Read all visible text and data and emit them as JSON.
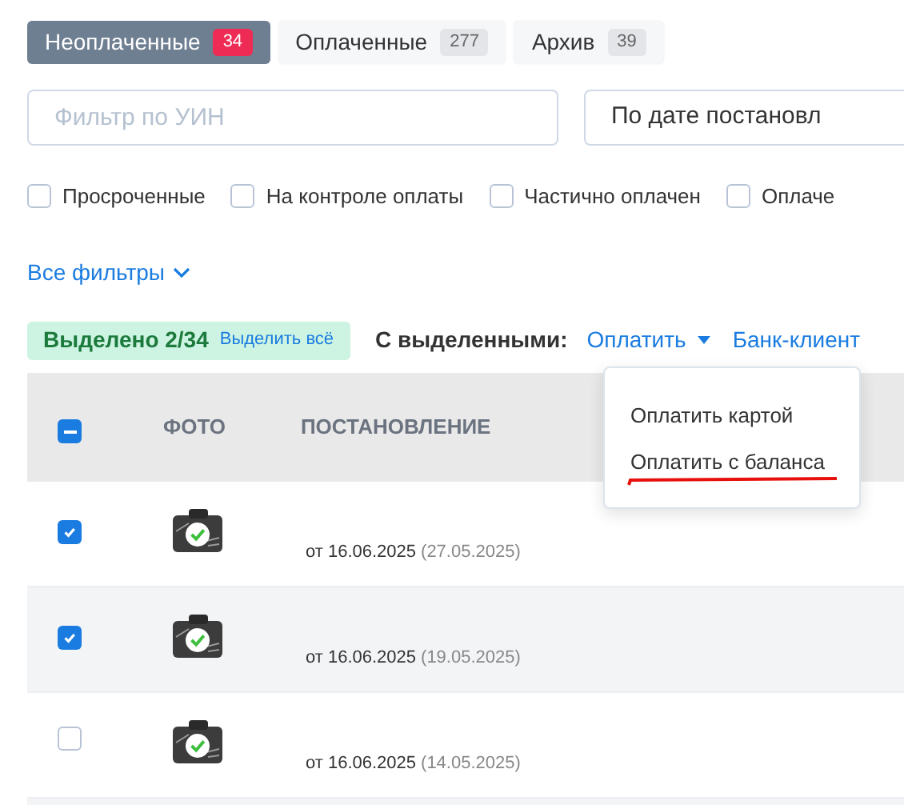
{
  "tabs": [
    {
      "label": "Неоплаченные",
      "count": "34",
      "selected": true
    },
    {
      "label": "Оплаченные",
      "count": "277",
      "selected": false
    },
    {
      "label": "Архив",
      "count": "39",
      "selected": false
    }
  ],
  "filter": {
    "placeholder": "Фильтр по УИН"
  },
  "sort": {
    "value": "По дате постановл"
  },
  "checkboxes": [
    {
      "label": "Просроченные",
      "checked": false
    },
    {
      "label": "На контроле оплаты",
      "checked": false
    },
    {
      "label": "Частично оплачен",
      "checked": false
    },
    {
      "label": "Оплаче",
      "checked": false
    }
  ],
  "all_filters": "Все фильтры",
  "selection": {
    "text": "Выделено 2/34",
    "select_all": "Выделить всё"
  },
  "bulk": {
    "label": "С выделенными:",
    "pay": "Оплатить",
    "bank": "Банк-клиент"
  },
  "menu": {
    "items": [
      "Оплатить картой",
      "Оплатить с баланса"
    ]
  },
  "table": {
    "header_indeterminate": true,
    "columns": [
      "ФОТО",
      "ПОСТАНОВЛЕНИЕ"
    ],
    "rows": [
      {
        "checked": true,
        "date": "от 16.06.2025",
        "orig_date": "(27.05.2025)"
      },
      {
        "checked": true,
        "date": "от 16.06.2025",
        "orig_date": "(19.05.2025)"
      },
      {
        "checked": false,
        "date": "от 16.06.2025",
        "orig_date": "(14.05.2025)"
      }
    ]
  }
}
